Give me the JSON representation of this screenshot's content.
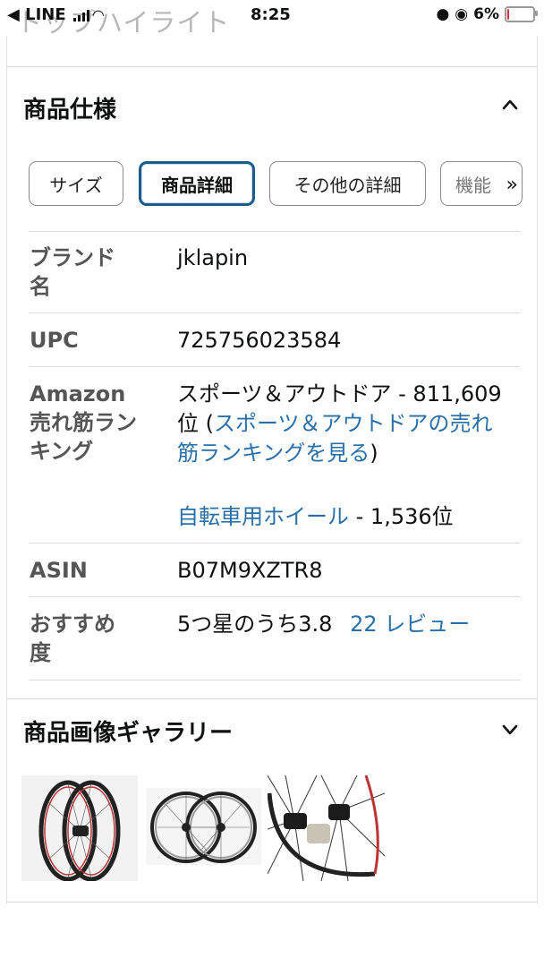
{
  "status_bar": {
    "back_app": "◀ LINE",
    "time": "8:25",
    "battery": "6%",
    "battery_level": 0.06,
    "ghost_title": "トップハイライト"
  },
  "specs_section": {
    "title": "商品仕様",
    "tabs": [
      {
        "label": "サイズ",
        "active": false
      },
      {
        "label": "商品詳細",
        "active": true
      },
      {
        "label": "その他の詳細",
        "active": false
      },
      {
        "label": "機能",
        "active": false
      }
    ],
    "rows": {
      "brand": {
        "label": "ブランド名",
        "value": "jklapin"
      },
      "upc": {
        "label": "UPC",
        "value": "725756023584"
      },
      "ranking": {
        "label": "Amazon 売れ筋ランキング",
        "main_rank": "スポーツ＆アウトドア - 811,609位",
        "main_link_open": " (",
        "main_link": "スポーツ＆アウトドアの売れ筋ランキングを見る",
        "main_link_close": ")",
        "sub_link": "自転車用ホイール",
        "sub_rank": " - 1,536位"
      },
      "asin": {
        "label": "ASIN",
        "value": "B07M9XZTR8"
      },
      "rating": {
        "label": "おすすめ度",
        "value": "5つ星のうち3.8",
        "reviews_link": "22 レビュー"
      }
    }
  },
  "gallery_section": {
    "title": "商品画像ギャラリー",
    "images": [
      {
        "name": "wheel-set-side-image"
      },
      {
        "name": "wheel-pair-image"
      },
      {
        "name": "hub-closeup-image"
      }
    ]
  },
  "colors": {
    "link": "#2a6fa8",
    "active_tab_border": "#1c5b8a",
    "label_gray": "#555555"
  }
}
